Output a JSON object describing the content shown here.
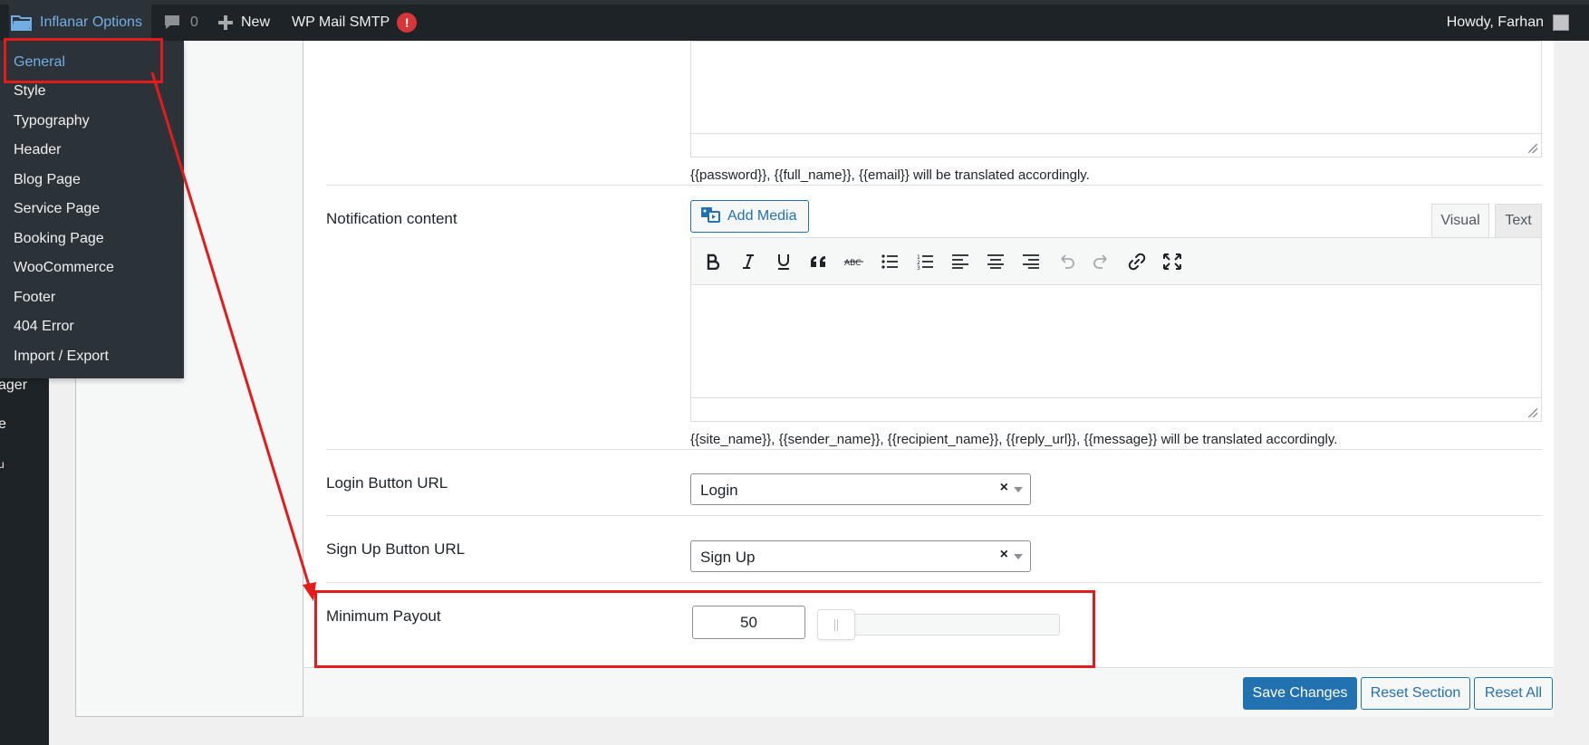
{
  "adminbar": {
    "site_name": "Inflanar Options",
    "comments_count": "0",
    "new_label": "New",
    "mail_plugin": "WP Mail SMTP",
    "mail_alert": "!",
    "howdy": "Howdy, Farhan"
  },
  "admin_menu_fragments": [
    "ager",
    "e",
    "u"
  ],
  "flyout": {
    "items": [
      {
        "label": "General"
      },
      {
        "label": "Style"
      },
      {
        "label": "Typography"
      },
      {
        "label": "Header"
      },
      {
        "label": "Blog Page"
      },
      {
        "label": "Service Page"
      },
      {
        "label": "Booking Page"
      },
      {
        "label": "WooCommerce"
      },
      {
        "label": "Footer"
      },
      {
        "label": "404 Error"
      },
      {
        "label": "Import / Export"
      }
    ],
    "current": "General"
  },
  "fields": {
    "prev_hint": "{{password}}, {{full_name}}, {{email}} will be translated accordingly.",
    "notification": {
      "label": "Notification content",
      "add_media": "Add Media",
      "tab_visual": "Visual",
      "tab_text": "Text",
      "hint": "{{site_name}}, {{sender_name}}, {{recipient_name}}, {{reply_url}}, {{message}} will be translated accordingly."
    },
    "login": {
      "label": "Login Button URL",
      "value": "Login",
      "clear": "×"
    },
    "signup": {
      "label": "Sign Up Button URL",
      "value": "Sign Up",
      "clear": "×"
    },
    "payout": {
      "label": "Minimum Payout",
      "value": "50"
    }
  },
  "toolbar_icons": [
    "bold-icon",
    "italic-icon",
    "underline-icon",
    "blockquote-icon",
    "strikethrough-icon",
    "bullet-list-icon",
    "numbered-list-icon",
    "align-left-icon",
    "align-center-icon",
    "align-right-icon",
    "undo-icon",
    "redo-icon",
    "link-icon",
    "fullscreen-icon"
  ],
  "footer": {
    "save": "Save Changes",
    "reset_section": "Reset Section",
    "reset_all": "Reset All"
  },
  "colors": {
    "adminbar_bg": "#1d2327",
    "link_blue": "#2271b1",
    "annotation_red": "#e31b1b",
    "alert_red": "#d63638"
  }
}
